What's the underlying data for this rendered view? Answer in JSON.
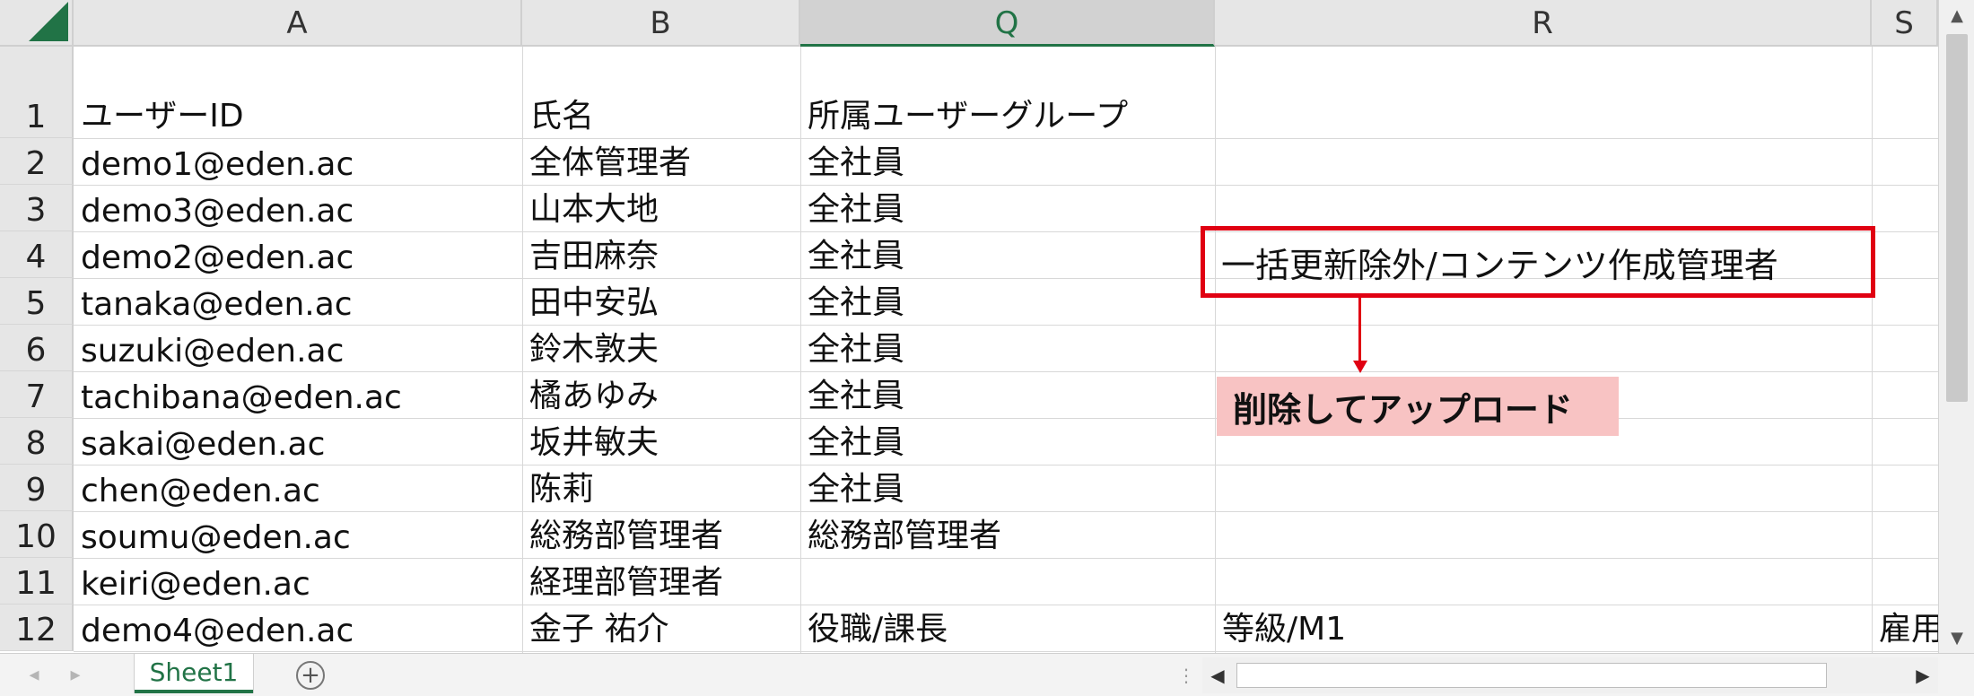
{
  "columns": [
    {
      "label": "A",
      "selected": false
    },
    {
      "label": "B",
      "selected": false
    },
    {
      "label": "Q",
      "selected": true
    },
    {
      "label": "R",
      "selected": false
    },
    {
      "label": "S",
      "selected": false
    }
  ],
  "rows": [
    {
      "num": "1",
      "cells": [
        "ユーザーID",
        "氏名",
        "所属ユーザーグループ",
        "",
        ""
      ]
    },
    {
      "num": "2",
      "cells": [
        "demo1@eden.ac",
        "全体管理者",
        "全社員",
        "",
        ""
      ]
    },
    {
      "num": "3",
      "cells": [
        "demo3@eden.ac",
        "山本大地",
        "全社員",
        "",
        ""
      ]
    },
    {
      "num": "4",
      "cells": [
        "demo2@eden.ac",
        "吉田麻奈",
        "全社員",
        "",
        ""
      ]
    },
    {
      "num": "5",
      "cells": [
        "tanaka@eden.ac",
        "田中安弘",
        "全社員",
        "",
        ""
      ]
    },
    {
      "num": "6",
      "cells": [
        "suzuki@eden.ac",
        "鈴木敦夫",
        "全社員",
        "",
        ""
      ]
    },
    {
      "num": "7",
      "cells": [
        "tachibana@eden.ac",
        "橘あゆみ",
        "全社員",
        "",
        ""
      ]
    },
    {
      "num": "8",
      "cells": [
        "sakai@eden.ac",
        "坂井敏夫",
        "全社員",
        "",
        ""
      ]
    },
    {
      "num": "9",
      "cells": [
        "chen@eden.ac",
        "陈莉",
        "全社員",
        "",
        ""
      ]
    },
    {
      "num": "10",
      "cells": [
        "soumu@eden.ac",
        "総務部管理者",
        "総務部管理者",
        "",
        ""
      ]
    },
    {
      "num": "11",
      "cells": [
        "keiri@eden.ac",
        "経理部管理者",
        "",
        "",
        ""
      ]
    },
    {
      "num": "12",
      "cells": [
        "demo4@eden.ac",
        "金子 祐介",
        "役職/課長",
        "等級/M1",
        "雇用"
      ]
    }
  ],
  "annotation": {
    "boxed_text": "一括更新除外/コンテンツ作成管理者",
    "label": "削除してアップロード",
    "color": "#e00012",
    "label_bg": "#f8c3c3"
  },
  "sheet_tab": "Sheet1",
  "accent": "#217346"
}
